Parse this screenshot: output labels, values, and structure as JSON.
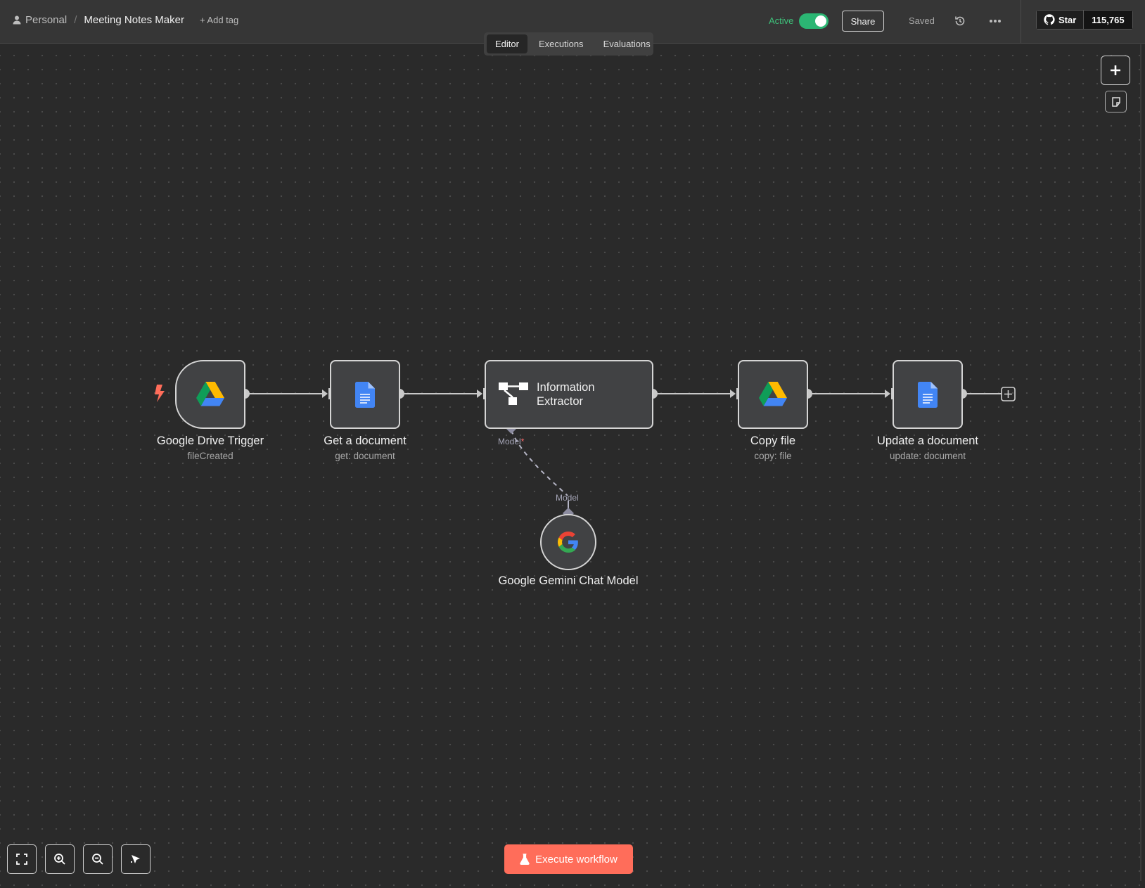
{
  "breadcrumb": {
    "project": "Personal",
    "separator": "/",
    "workflow_name": "Meeting Notes Maker",
    "add_tag": "+ Add tag"
  },
  "header": {
    "active_label": "Active",
    "active_on": true,
    "share_label": "Share",
    "saved_label": "Saved",
    "github_star_label": "Star",
    "github_star_count": "115,765"
  },
  "tabs": [
    {
      "label": "Editor",
      "active": true
    },
    {
      "label": "Executions",
      "active": false
    },
    {
      "label": "Evaluations",
      "active": false
    }
  ],
  "nodes": {
    "drive_trigger": {
      "title": "Google Drive Trigger",
      "subtitle": "fileCreated",
      "icon": "google-drive-icon"
    },
    "get_document": {
      "title": "Get a document",
      "subtitle": "get: document",
      "icon": "google-docs-icon"
    },
    "info_extractor": {
      "title": "Information Extractor",
      "icon": "information-extractor-icon",
      "input_label": "Model",
      "input_required_mark": "*"
    },
    "copy_file": {
      "title": "Copy file",
      "subtitle": "copy: file",
      "icon": "google-drive-icon"
    },
    "update_document": {
      "title": "Update a document",
      "subtitle": "update: document",
      "icon": "google-docs-icon"
    },
    "gemini_model": {
      "title": "Google Gemini Chat Model",
      "icon": "google-icon",
      "output_label": "Model"
    }
  },
  "footer": {
    "execute_label": "Execute workflow"
  },
  "colors": {
    "accent": "#ff6d5a",
    "active_green": "#2bb673",
    "canvas_bg": "#2a2a2a",
    "node_bg": "#414244"
  }
}
